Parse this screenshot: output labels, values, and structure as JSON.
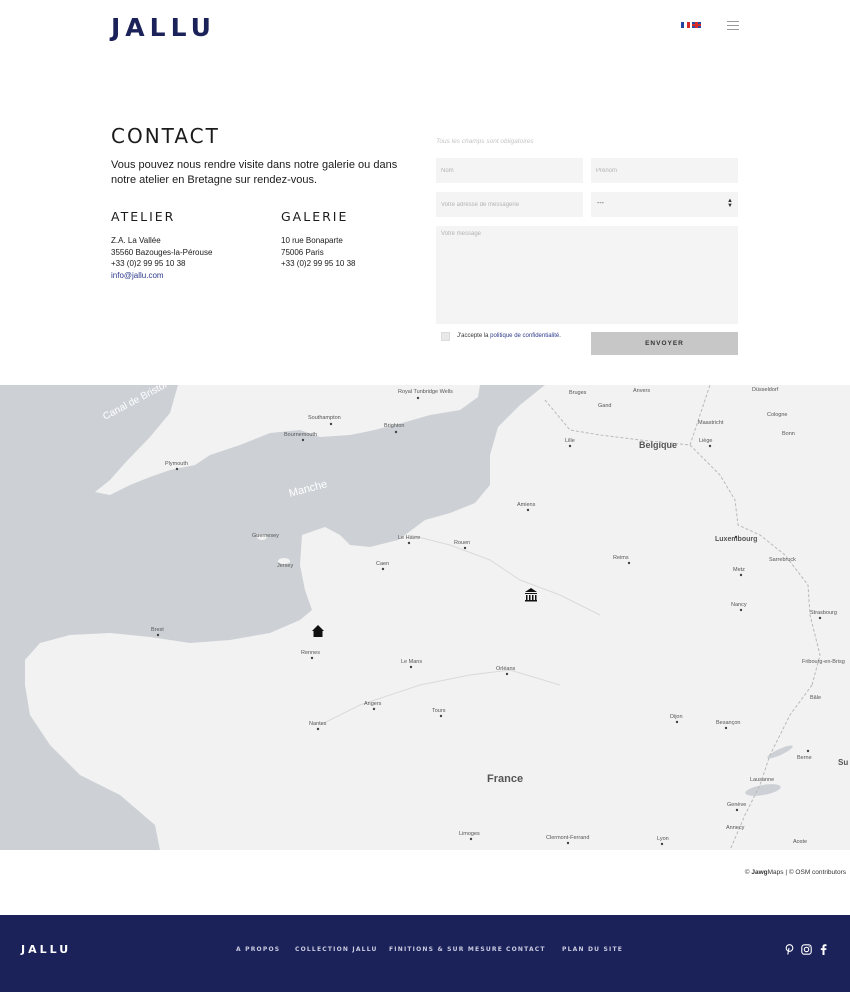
{
  "header": {
    "logo": "JALLU",
    "languages": [
      "fr-flag-icon",
      "en-flag-icon"
    ],
    "menu_icon": "hamburger-menu-icon"
  },
  "contact": {
    "title": "CONTACT",
    "intro": "Vous pouvez nous rendre visite dans notre galerie ou dans notre atelier en Bretagne sur rendez-vous.",
    "atelier": {
      "title": "ATELIER",
      "lines": [
        "Z.A. La Vallée",
        "35560 Bazouges-la-Pérouse",
        "+33 (0)2 99 95 10 38"
      ],
      "email": "info@jallu.com"
    },
    "galerie": {
      "title": "GALERIE",
      "lines": [
        "10 rue Bonaparte",
        "75006 Paris",
        "+33 (0)2 99 95 10 38"
      ]
    }
  },
  "form": {
    "note": "Tous les champs sont obligatoires",
    "nom_placeholder": "Nom",
    "prenom_placeholder": "Prénom",
    "email_placeholder": "Votre adresse de messagerie",
    "select_value": "---",
    "message_placeholder": "Votre message",
    "consent_prefix": "J'accepte la ",
    "consent_link": "politique de confidentialité",
    "consent_suffix": ".",
    "submit_label": "ENVOYER"
  },
  "map": {
    "sea_labels": [
      "Manche",
      "Canal de Bristol"
    ],
    "country_labels": [
      "France",
      "Belgique",
      "Luxembourg"
    ],
    "cities": [
      "Royal Tunbridge Wells",
      "Southampton",
      "Brighton",
      "Bournemouth",
      "Plymouth",
      "Guernesey",
      "Jersey",
      "Le Havre",
      "Rouen",
      "Caen",
      "Amiens",
      "Lille",
      "Bruges",
      "Gand",
      "Anvers",
      "Maastricht",
      "Liège",
      "Düsseldorf",
      "Cologne",
      "Bonn",
      "Reims",
      "Metz",
      "Sarrebruck",
      "Nancy",
      "Strasbourg",
      "Fribourg-en-Brisg",
      "Bâle",
      "Berne",
      "Brest",
      "Rennes",
      "Le Mans",
      "Orléans",
      "Angers",
      "Tours",
      "Nantes",
      "Dijon",
      "Besançon",
      "Lausanne",
      "Genève",
      "Annecy",
      "Limoges",
      "Clermont-Ferrand",
      "Lyon",
      "Aoste",
      "Su"
    ],
    "markers": [
      "museum-icon",
      "home-icon"
    ],
    "attribution_prefix": "© ",
    "attribution_brand_bold": "Jawg",
    "attribution_brand_rest": "Maps",
    "attribution_suffix": " | © OSM contributors"
  },
  "footer": {
    "logo": "JALLU",
    "links": [
      "A PROPOS",
      "COLLECTION JALLU",
      "FINITIONS & SUR MESURE",
      "CONTACT",
      "PLAN DU SITE"
    ],
    "social": [
      "pinterest-icon",
      "instagram-icon",
      "facebook-icon"
    ]
  },
  "colors": {
    "brand_navy": "#1b2259",
    "link_blue": "#2d3a8c",
    "sea": "#cdd1d6",
    "land": "#f2f2f2",
    "button_grey": "#c7c7c7"
  }
}
